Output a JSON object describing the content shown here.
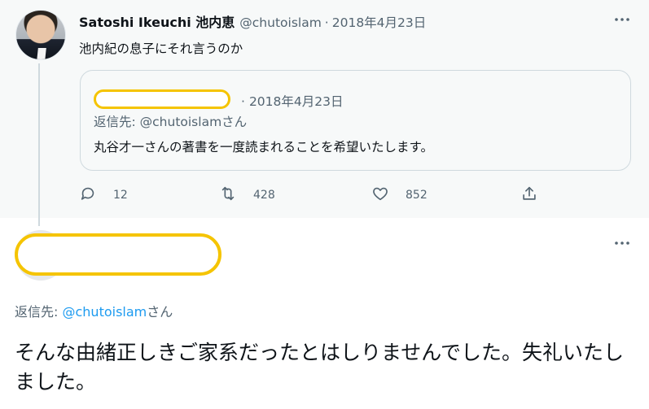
{
  "parent_tweet": {
    "display_name": "Satoshi Ikeuchi 池内恵",
    "handle": "@chutoislam",
    "separator": "·",
    "date": "2018年4月23日",
    "text": "池内紀の息子にそれ言うのか",
    "quoted_tweet": {
      "separator": "·",
      "date": "2018年4月23日",
      "reply_to_label": "返信先: @chutoislamさん",
      "text": "丸谷才一さんの著書を一度読まれることを希望いたします。"
    },
    "actions": {
      "reply_count": "12",
      "retweet_count": "428",
      "like_count": "852"
    }
  },
  "reply_tweet": {
    "reply_to_prefix": "返信先: ",
    "reply_to_handle": "@chutoislam",
    "reply_to_suffix": "さん",
    "text": "そんな由緒正しきご家系だったとはしりませんでした。失礼いたしました。"
  },
  "icons": {
    "more": "more-horizontal-icon",
    "reply": "reply-icon",
    "retweet": "retweet-icon",
    "like": "heart-icon",
    "share": "share-icon"
  },
  "colors": {
    "text_primary": "#0f1419",
    "text_secondary": "#536471",
    "link": "#1d9bf0",
    "redaction": "#f5c400",
    "background_parent": "#f7f9f9"
  }
}
